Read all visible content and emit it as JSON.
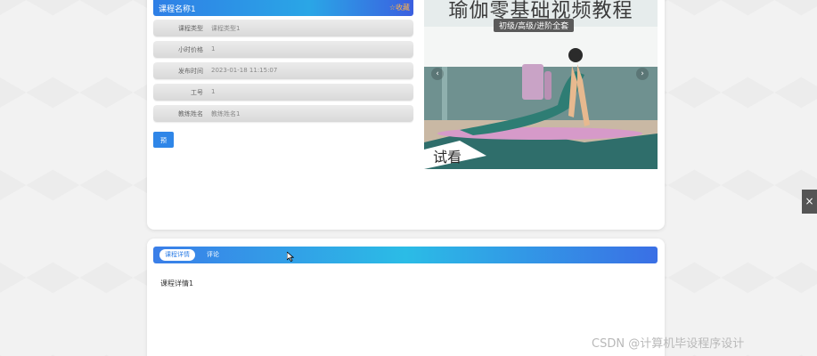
{
  "course": {
    "header_title": "课程名称1",
    "favorite_label": "☆收藏",
    "fields": [
      {
        "label": "课程类型",
        "value": "课程类型1"
      },
      {
        "label": "小时价格",
        "value": "1"
      },
      {
        "label": "发布时间",
        "value": "2023-01-18 11:15:07"
      },
      {
        "label": "工号",
        "value": "1"
      },
      {
        "label": "教练姓名",
        "value": "教练姓名1"
      }
    ],
    "book_label": "预约"
  },
  "banner": {
    "title": "瑜伽零基础视频教程",
    "subtitle": "初级/高级/进阶全套",
    "try_label": "试看",
    "prev_icon": "‹",
    "next_icon": "›"
  },
  "tabs": {
    "detail_label": "课程详情",
    "comment_label": "评论",
    "detail_content": "课程详情1"
  },
  "side_toggle_icon": "×",
  "watermark": "CSDN @计算机毕设程序设计",
  "colors": {
    "accent": "#2f86e8",
    "favorite": "#ffb347"
  }
}
